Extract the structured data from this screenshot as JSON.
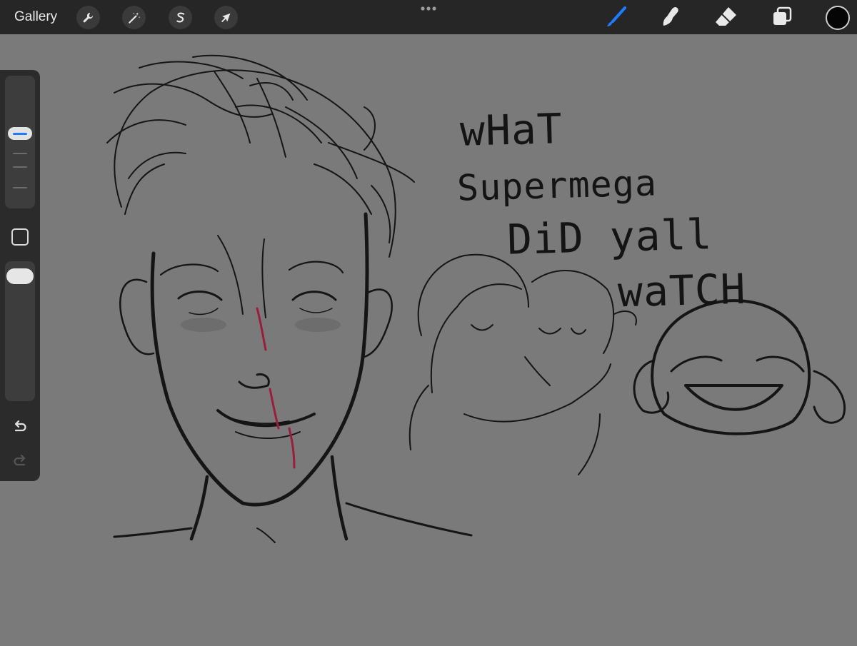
{
  "toolbar": {
    "gallery_label": "Gallery",
    "left_tools": [
      {
        "name": "actions",
        "icon": "wrench-icon"
      },
      {
        "name": "adjustments",
        "icon": "magic-wand-icon"
      },
      {
        "name": "selection",
        "icon": "selection-s-icon"
      },
      {
        "name": "transform",
        "icon": "arrow-cursor-icon"
      }
    ],
    "right_tools": [
      {
        "name": "brush",
        "icon": "brush-icon",
        "active": true
      },
      {
        "name": "smudge",
        "icon": "smudge-finger-icon",
        "active": false
      },
      {
        "name": "eraser",
        "icon": "eraser-icon",
        "active": false
      },
      {
        "name": "layers",
        "icon": "layers-icon",
        "active": false
      }
    ],
    "active_color": "#050505",
    "accent_color": "#1f7bff"
  },
  "sidebar": {
    "brush_size_icon": "size-slider",
    "modifier_icon": "square-modifier-icon",
    "opacity_icon": "opacity-slider",
    "undo_icon": "undo-arrow-icon",
    "redo_icon": "redo-arrow-icon"
  },
  "canvas": {
    "background": "#7a7a7a",
    "handwriting_lines": [
      "wHaT",
      "Supermega",
      "DiD yall",
      "waTCH"
    ]
  }
}
